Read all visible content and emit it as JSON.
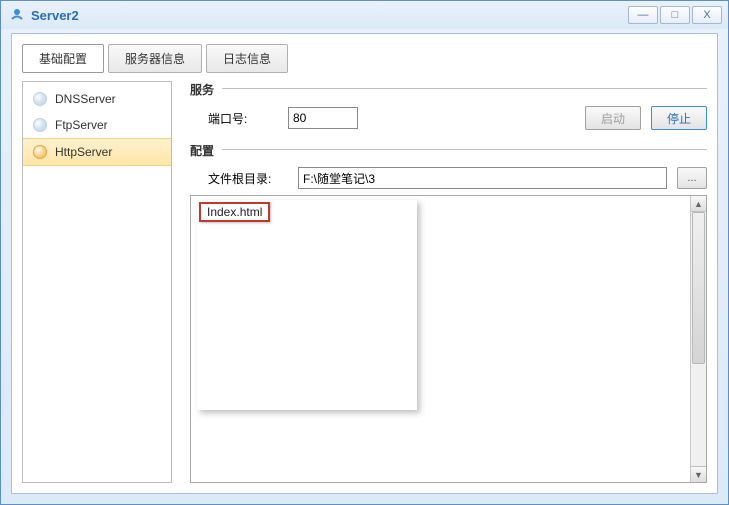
{
  "window": {
    "title": "Server2"
  },
  "winButtons": {
    "min": "—",
    "max": "□",
    "close": "X"
  },
  "tabs": {
    "basic": "基础配置",
    "server": "服务器信息",
    "log": "日志信息"
  },
  "sidebar": {
    "items": [
      {
        "label": "DNSServer"
      },
      {
        "label": "FtpServer"
      },
      {
        "label": "HttpServer"
      }
    ]
  },
  "service": {
    "title": "服务",
    "portLabel": "端口号:",
    "portValue": "80",
    "startLabel": "启动",
    "stopLabel": "停止"
  },
  "config": {
    "title": "配置",
    "rootLabel": "文件根目录:",
    "rootValue": "F:\\随堂笔记\\3",
    "browseLabel": "..."
  },
  "files": {
    "items": [
      {
        "name": "Index.html"
      }
    ]
  }
}
